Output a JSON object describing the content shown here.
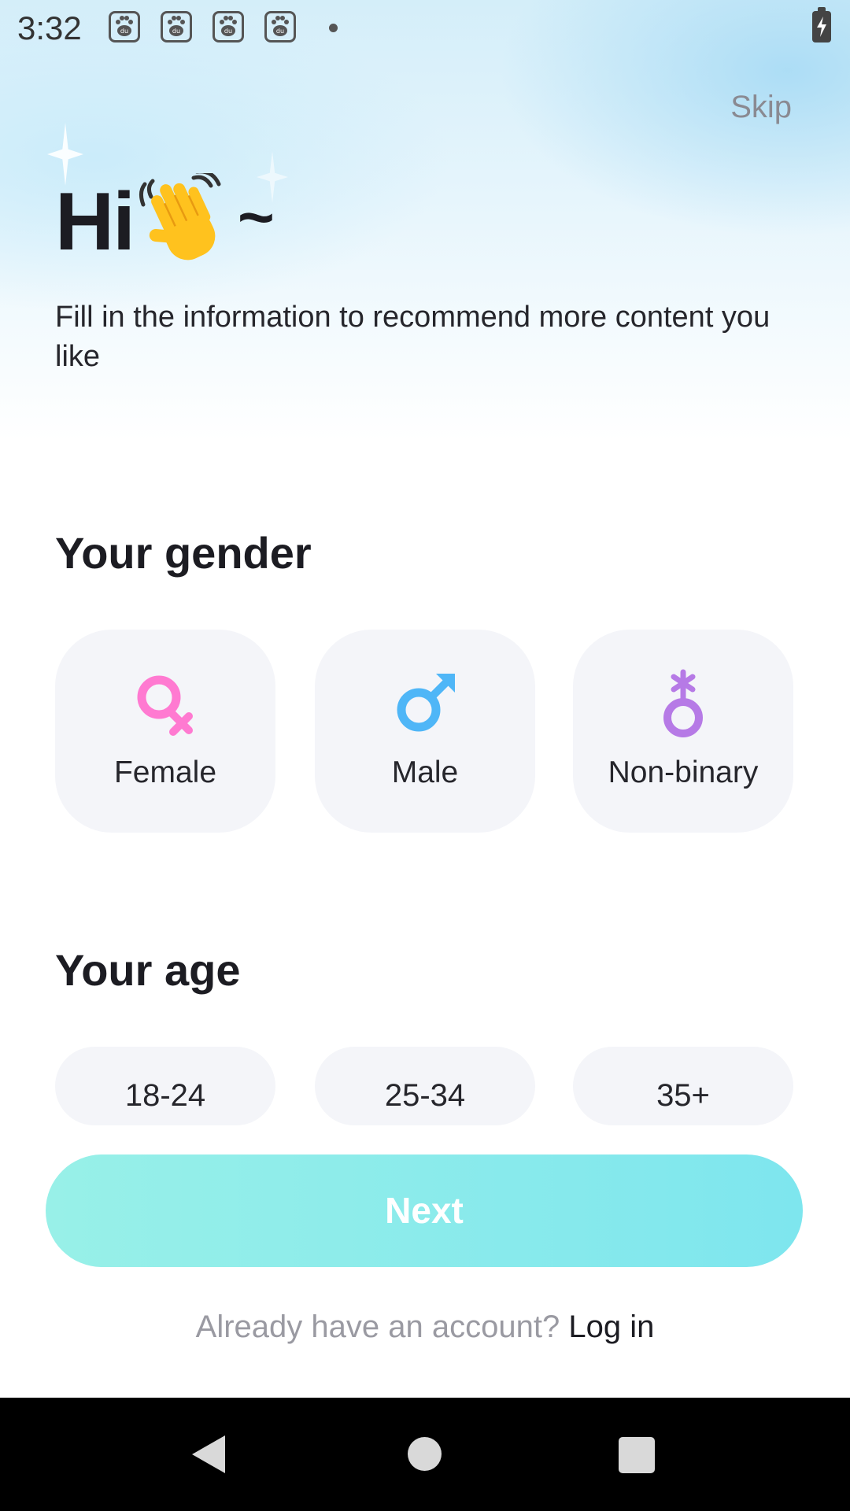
{
  "status_bar": {
    "time": "3:32",
    "notification_icons": [
      "baidu-paw-icon",
      "baidu-paw-icon",
      "baidu-paw-icon",
      "baidu-paw-icon"
    ],
    "battery_icon": "battery-charging-icon"
  },
  "header": {
    "skip_label": "Skip",
    "greeting": "Hi",
    "greeting_emoji": "waving-hand-icon",
    "greeting_suffix": "~",
    "subtitle": "Fill in the information to recommend more content you like"
  },
  "gender": {
    "title": "Your gender",
    "options": [
      {
        "label": "Female",
        "icon": "female-symbol-icon",
        "color": "#ff7ad1"
      },
      {
        "label": "Male",
        "icon": "male-symbol-icon",
        "color": "#4fb6f7"
      },
      {
        "label": "Non-binary",
        "icon": "non-binary-symbol-icon",
        "color": "#b67ae6"
      }
    ]
  },
  "age": {
    "title": "Your age",
    "options": [
      {
        "label": "18-24"
      },
      {
        "label": "25-34"
      },
      {
        "label": "35+"
      }
    ]
  },
  "actions": {
    "next_label": "Next",
    "next_color": "#8eeee9",
    "login_prompt": "Already have an account?",
    "login_link": "Log in"
  },
  "nav_bar": {
    "back_icon": "back-triangle-icon",
    "home_icon": "home-circle-icon",
    "recents_icon": "recents-square-icon"
  }
}
